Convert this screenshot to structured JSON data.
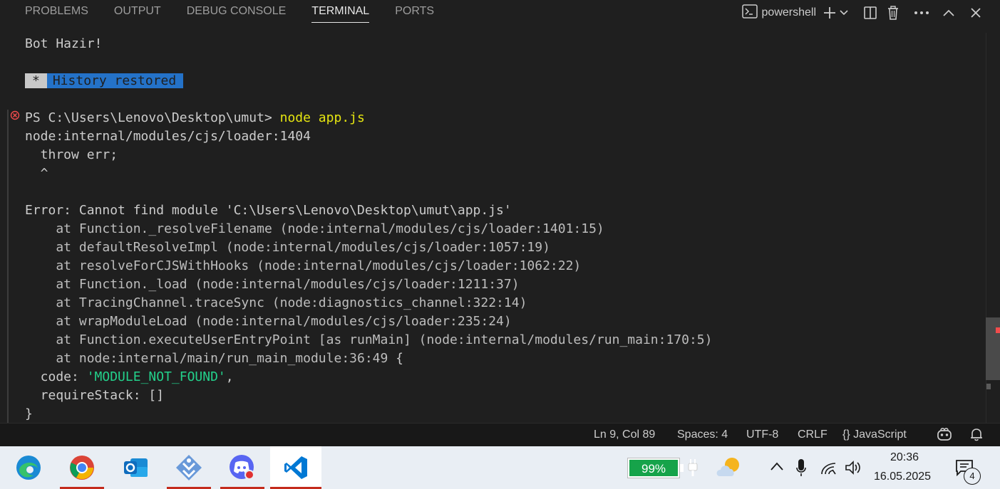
{
  "panel": {
    "tabs": [
      {
        "label": "PROBLEMS",
        "active": false
      },
      {
        "label": "OUTPUT",
        "active": false
      },
      {
        "label": "DEBUG CONSOLE",
        "active": false
      },
      {
        "label": "TERMINAL",
        "active": true
      },
      {
        "label": "PORTS",
        "active": false
      }
    ],
    "shell_label": "powershell"
  },
  "terminal": {
    "lines": [
      "Bot Hazir!",
      "PS C:\\Users\\Lenovo\\Desktop\\umut> ",
      "node:internal/modules/cjs/loader:1404",
      "  throw err;",
      "  ^",
      "Error: Cannot find module 'C:\\Users\\Lenovo\\Desktop\\umut\\app.js'",
      "    at Function._resolveFilename (node:internal/modules/cjs/loader:1401:15)",
      "    at defaultResolveImpl (node:internal/modules/cjs/loader:1057:19)",
      "    at resolveForCJSWithHooks (node:internal/modules/cjs/loader:1062:22)",
      "    at Function._load (node:internal/modules/cjs/loader:1211:37)",
      "    at TracingChannel.traceSync (node:diagnostics_channel:322:14)",
      "    at wrapModuleLoad (node:internal/modules/cjs/loader:235:24)",
      "    at Function.executeUserEntryPoint [as runMain] (node:internal/modules/run_main:170:5)",
      "    at node:internal/main/run_main_module:36:49 ",
      "  code: ",
      "  requireStack: []",
      "}"
    ],
    "history_star": "*",
    "history_text": "History restored",
    "command": "node app.js",
    "open_brace": "{",
    "code_value": "'MODULE_NOT_FOUND'",
    "code_suffix": ","
  },
  "status": {
    "position": "Ln 9, Col 89",
    "spaces": "Spaces: 4",
    "encoding": "UTF-8",
    "eol": "CRLF",
    "language_braces": "{}",
    "language": "JavaScript"
  },
  "taskbar": {
    "battery": "99%",
    "time": "20:36",
    "date": "16.05.2025",
    "notifications": "4"
  },
  "colors": {
    "terminal_bg": "#1f1f1f",
    "command_yellow": "#e5e510",
    "string_green": "#23d18b",
    "history_blue": "#2472c8",
    "error_red": "#f14c4c",
    "battery_green": "#16a34a"
  }
}
